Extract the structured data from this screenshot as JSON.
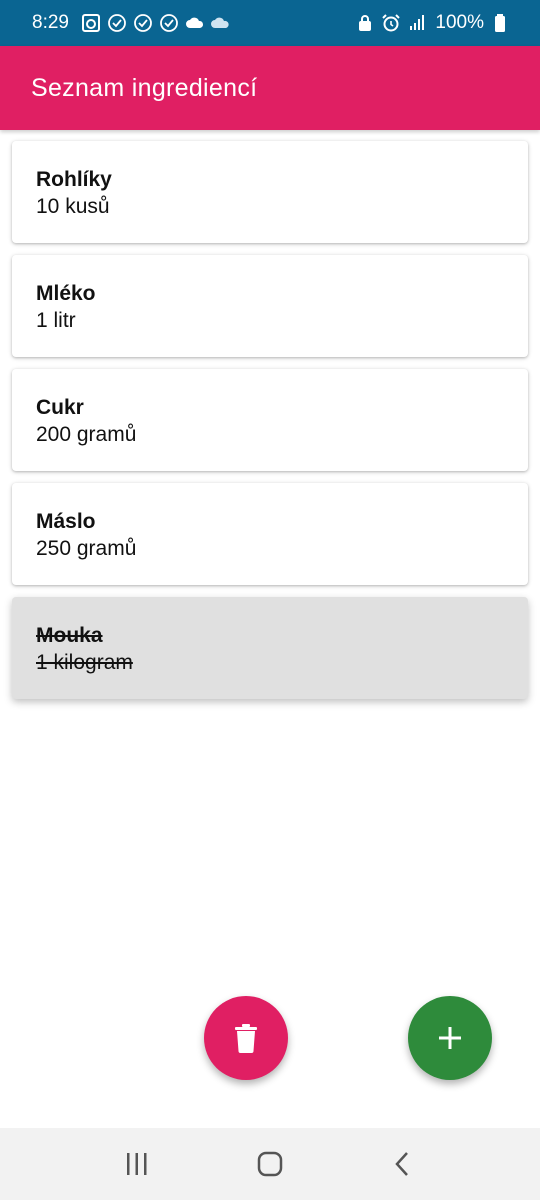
{
  "status_bar": {
    "time": "8:29",
    "battery": "100%",
    "left_icons": [
      "photo-icon",
      "check-circle-icon",
      "check-circle-icon",
      "check-circle-icon",
      "cloud-icon",
      "cloud-icon"
    ],
    "right_icons": [
      "lock-icon",
      "alarm-icon",
      "signal-icon",
      "battery-icon"
    ]
  },
  "app_bar": {
    "title": "Seznam ingrediencí"
  },
  "ingredients": [
    {
      "name": "Rohlíky",
      "quantity": "10 kusů",
      "done": false
    },
    {
      "name": "Mléko",
      "quantity": "1 litr",
      "done": false
    },
    {
      "name": "Cukr",
      "quantity": "200 gramů",
      "done": false
    },
    {
      "name": "Máslo",
      "quantity": "250 gramů",
      "done": false
    },
    {
      "name": "Mouka",
      "quantity": "1 kilogram",
      "done": true
    }
  ],
  "fabs": {
    "delete_icon": "trash-icon",
    "add_icon": "plus-icon"
  },
  "nav": {
    "icons": [
      "recents-icon",
      "home-icon",
      "back-icon"
    ]
  },
  "colors": {
    "status_bar": "#0a6592",
    "accent": "#e01f63",
    "add": "#2e8b3b"
  }
}
